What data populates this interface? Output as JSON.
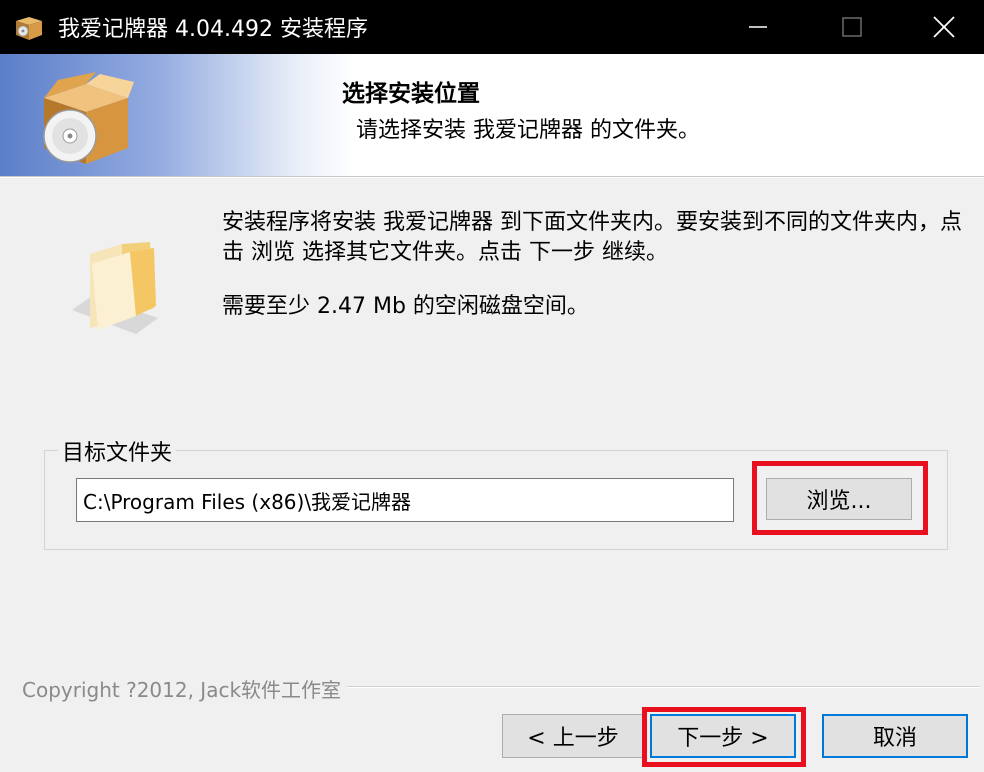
{
  "window": {
    "title": "我爱记牌器 4.04.492 安装程序",
    "icons": {
      "app": "installer-box-icon",
      "minimize": "minimize-icon",
      "maximize": "maximize-icon",
      "close": "close-icon"
    }
  },
  "header": {
    "title": "选择安装位置",
    "subtitle": "请选择安装 我爱记牌器 的文件夹。",
    "icon": "installer-cd-box-icon"
  },
  "body": {
    "description": "安装程序将安装 我爱记牌器 到下面文件夹内。要安装到不同的文件夹内，点击 浏览 选择其它文件夹。点击 下一步 继续。",
    "space_required": "需要至少 2.47 Mb 的空闲磁盘空间。",
    "folder_icon": "folder-icon"
  },
  "target_folder": {
    "label": "目标文件夹",
    "path": "C:\\Program Files (x86)\\我爱记牌器",
    "browse_label": "浏览..."
  },
  "footer": {
    "copyright": "Copyright ?2012, Jack软件工作室",
    "prev_label": "< 上一步",
    "next_label": "下一步 >",
    "cancel_label": "取消"
  },
  "colors": {
    "highlight": "#e8101e",
    "titlebar": "#000000",
    "focus_border": "#0078d7"
  }
}
